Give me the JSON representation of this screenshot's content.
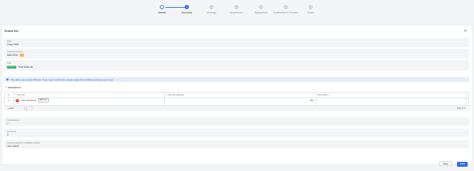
{
  "stepper": {
    "steps": [
      {
        "number": "✓",
        "label": "Details"
      },
      {
        "number": "2",
        "label": "Accounts"
      },
      {
        "number": "3",
        "label": "Vestings"
      },
      {
        "number": "4",
        "label": "Documents"
      },
      {
        "number": "5",
        "label": "Signatories"
      },
      {
        "number": "6",
        "label": "Notification & Review"
      },
      {
        "number": "7",
        "label": "Grant"
      }
    ]
  },
  "card": {
    "title": "Grants list",
    "close_icon": "✕"
  },
  "details": {
    "date_label": "Date",
    "date_value": "3 Apr 2026",
    "granted_label": "Granted security",
    "granted_value": "AAA 2026",
    "granted_badge": "TS",
    "pool_label": "Pool",
    "pool_badge": "Ongoing",
    "pool_value": "Pool 2026 bis"
  },
  "notice": {
    "icon": "i",
    "text": "This table only accepts 50 lines. If you need to add more, please replay this workflow as long as you need."
  },
  "transactions": {
    "section_label": "* Transactions",
    "columns": {
      "num": "#",
      "account": "* Account",
      "quantity": "* Granted quantity",
      "description": "Description"
    },
    "rows": [
      {
        "num": "1",
        "avatar": "VT",
        "name": "Vitya TATSUYA",
        "tag": "BEN-112",
        "quantity": "100",
        "description": ""
      }
    ],
    "add_label": "+ Add",
    "add_qty": "1",
    "pager": "Size   5 ∨"
  },
  "summary": {
    "transactions_label": "Transactions",
    "transactions_value": "1",
    "accounts_label": "Accounts",
    "accounts_value": "1",
    "qty_label": "Granted quantity / Available shares",
    "qty_value": "100 / 8,847"
  },
  "footer": {
    "back_label": "Back",
    "next_label": "Next"
  },
  "colors": {
    "accent": "#2f6de1",
    "badge_ts": "#f0a93b",
    "badge_ongoing": "#27ae60",
    "avatar": "#e74c3c"
  }
}
